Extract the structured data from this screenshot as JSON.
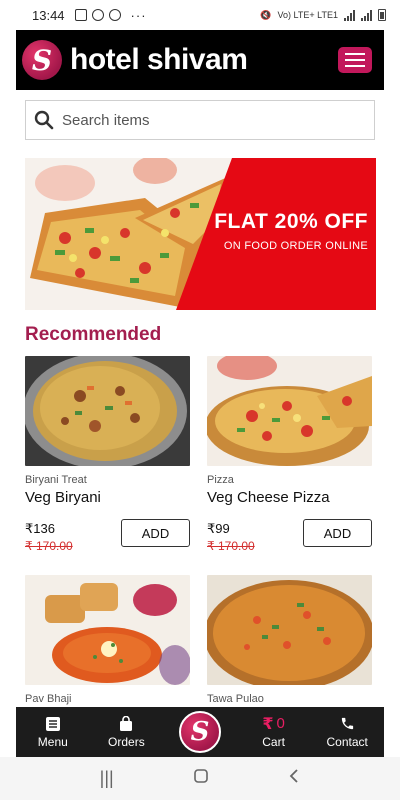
{
  "status_bar": {
    "time": "13:44",
    "network": "Vo) LTE+ LTE1",
    "more": "···"
  },
  "header": {
    "logo_letter": "S",
    "brand": "hotel shivam"
  },
  "search": {
    "placeholder": "Search items"
  },
  "banner": {
    "headline": "FLAT 20% OFF",
    "subtext": "ON FOOD ORDER ONLINE"
  },
  "section": {
    "title": "Recommended"
  },
  "products": [
    {
      "category": "Biryani Treat",
      "name": "Veg Biryani",
      "price": "₹136",
      "old_price": "₹ 170.00",
      "add_label": "ADD",
      "image": "biryani"
    },
    {
      "category": "Pizza",
      "name": "Veg Cheese Pizza",
      "price": "₹99",
      "old_price": "₹ 170.00",
      "add_label": "ADD",
      "image": "pizza"
    },
    {
      "category": "Pav Bhaji",
      "image": "pav-bhaji"
    },
    {
      "category": "Tawa Pulao",
      "image": "tawa-pulao"
    }
  ],
  "bottom_nav": {
    "menu": "Menu",
    "orders": "Orders",
    "cart": "Cart",
    "cart_symbol": "₹",
    "cart_count": "0",
    "contact": "Contact",
    "logo_letter": "S"
  },
  "colors": {
    "brand": "#c2185b",
    "title": "#a31e4f",
    "banner_red": "#e50914",
    "header_bg": "#000000",
    "nav_bg": "#1c1c1c"
  }
}
